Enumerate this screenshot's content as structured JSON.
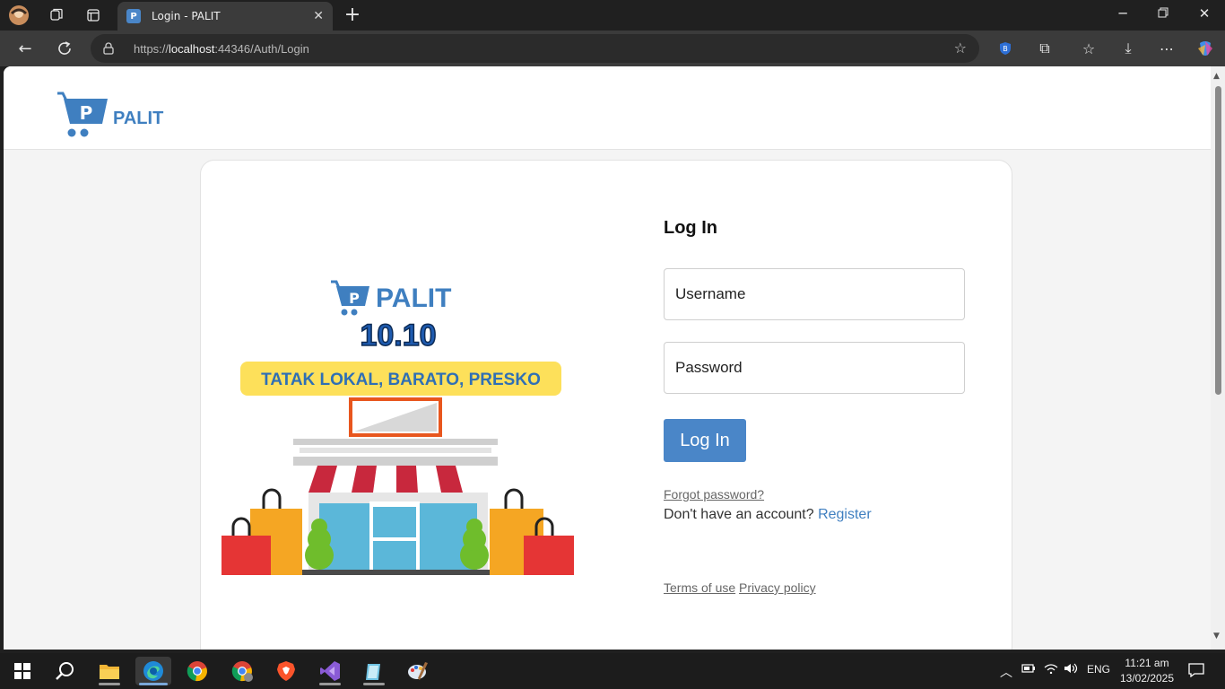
{
  "browser": {
    "tab_title": "Login - PALIT",
    "tab_favicon_letter": "P",
    "url_host": "localhost",
    "url_scheme": "https://",
    "url_rest": ":44346/Auth/Login",
    "accent": "#4a86c8"
  },
  "site": {
    "brand": "PALIT",
    "brand_color": "#3f7fc0"
  },
  "promo": {
    "brand": "PALIT",
    "date": "10.10",
    "tagline": "TATAK LOKAL, BARATO, PRESKO"
  },
  "login": {
    "title": "Log In",
    "username_placeholder": "Username",
    "password_placeholder": "Password",
    "submit_label": "Log In",
    "forgot_label": "Forgot password?",
    "no_account_text": "Don't have an account?",
    "register_label": "Register",
    "terms_label": "Terms of use",
    "privacy_label": "Privacy policy"
  },
  "taskbar": {
    "language": "ENG",
    "time": "11:21 am",
    "date": "13/02/2025"
  }
}
